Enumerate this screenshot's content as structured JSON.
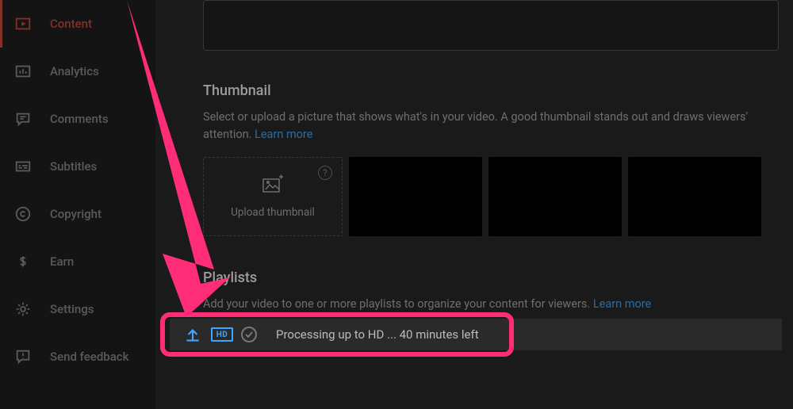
{
  "sidebar": {
    "items": [
      {
        "label": "Content",
        "active": true
      },
      {
        "label": "Analytics",
        "active": false
      },
      {
        "label": "Comments",
        "active": false
      },
      {
        "label": "Subtitles",
        "active": false
      },
      {
        "label": "Copyright",
        "active": false
      },
      {
        "label": "Earn",
        "active": false
      },
      {
        "label": "Settings",
        "active": false
      },
      {
        "label": "Send feedback",
        "active": false
      }
    ]
  },
  "thumbnail": {
    "title": "Thumbnail",
    "desc": "Select or upload a picture that shows what's in your video. A good thumbnail stands out and draws viewers' attention. ",
    "learn_more": "Learn more",
    "upload_label": "Upload thumbnail"
  },
  "playlists": {
    "title": "Playlists",
    "desc": "Add your video to one or more playlists to organize your content for viewers. ",
    "learn_more": "Learn more"
  },
  "processing": {
    "hd_label": "HD",
    "status": "Processing up to HD ... 40 minutes left"
  }
}
